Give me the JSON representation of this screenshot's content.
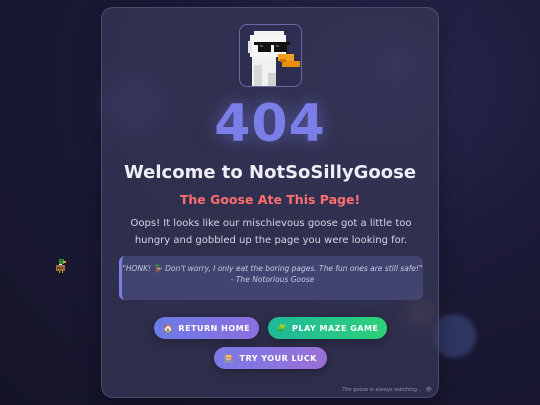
{
  "error_code": "404",
  "title": "Welcome to NotSoSillyGoose",
  "subtitle": "The Goose Ate This Page!",
  "description": "Oops! It looks like our mischievous goose got a little too hungry and gobbled up the page you were looking for.",
  "quote": {
    "text": "\"HONK! 🦆 Don't worry, I only eat the boring pages. The fun ones are still safe!\"",
    "author": "- The Notorious Goose"
  },
  "buttons": {
    "home_icon": "🏠",
    "home": "RETURN HOME",
    "maze_icon": "🧩",
    "maze": "PLAY MAZE GAME",
    "luck_icon": "🎰",
    "luck": "TRY YOUR LUCK"
  },
  "footer": {
    "text": "The goose is always watching...",
    "icon": "eye-icon"
  },
  "colors": {
    "accent": "#7a7ee6",
    "subtitle": "#ff6f6f",
    "maze_button": "#22c08c"
  }
}
